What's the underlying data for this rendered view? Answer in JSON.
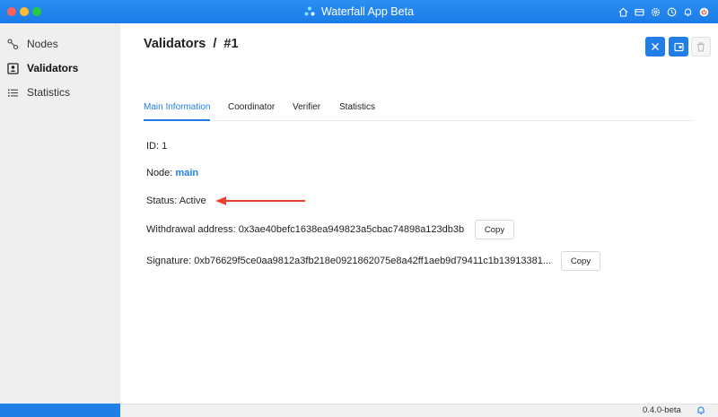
{
  "window": {
    "title": "Waterfall App Beta"
  },
  "sidebar": {
    "items": [
      {
        "label": "Nodes",
        "icon": "nodes-icon",
        "active": false
      },
      {
        "label": "Validators",
        "icon": "validators-icon",
        "active": true
      },
      {
        "label": "Statistics",
        "icon": "list-icon",
        "active": false
      }
    ]
  },
  "page": {
    "title": "Validators",
    "separator": "/",
    "id_label": "#1"
  },
  "tabs": [
    {
      "label": "Main Information",
      "active": true
    },
    {
      "label": "Coordinator",
      "active": false
    },
    {
      "label": "Verifier",
      "active": false
    },
    {
      "label": "Statistics",
      "active": false
    }
  ],
  "info": {
    "id_label": "ID:",
    "id_value": "1",
    "node_label": "Node:",
    "node_value": "main",
    "status_label": "Status:",
    "status_value": "Active",
    "withdrawal_label": "Withdrawal address:",
    "withdrawal_value": "0x3ae40befc1638ea949823a5cbac74898a123db3b",
    "signature_label": "Signature:",
    "signature_value": "0xb76629f5ce0aa9812a3fb218e0921862075e8a42ff1aeb9d79411c1b13913381..."
  },
  "copy_label": "Copy",
  "footer": {
    "version": "0.4.0-beta"
  },
  "colors": {
    "accent": "#1f7fe6",
    "annotation_arrow": "#e8432e"
  }
}
